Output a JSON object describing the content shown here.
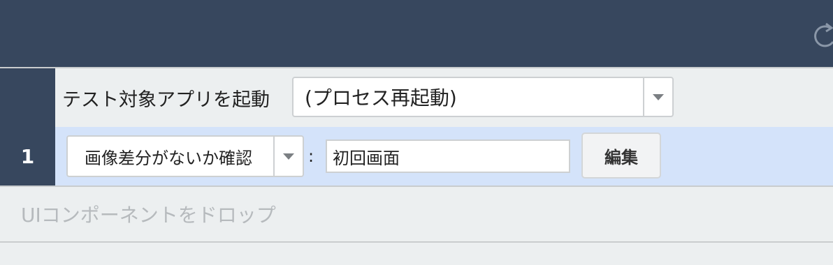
{
  "header": {
    "refresh_icon": "refresh-icon",
    "background": "#37475e"
  },
  "setup_row": {
    "label": "テスト対象アプリを起動",
    "select_value": "(プロセス再起動)"
  },
  "steps": [
    {
      "number": "1",
      "action": "画像差分がないか確認",
      "separator": ":",
      "input_value": "初回画面",
      "edit_label": "編集"
    }
  ],
  "drop_zone": {
    "hint": "UIコンポーネントをドロップ"
  },
  "colors": {
    "step_highlight": "#d4e3fa",
    "panel_background": "#eceff0"
  }
}
